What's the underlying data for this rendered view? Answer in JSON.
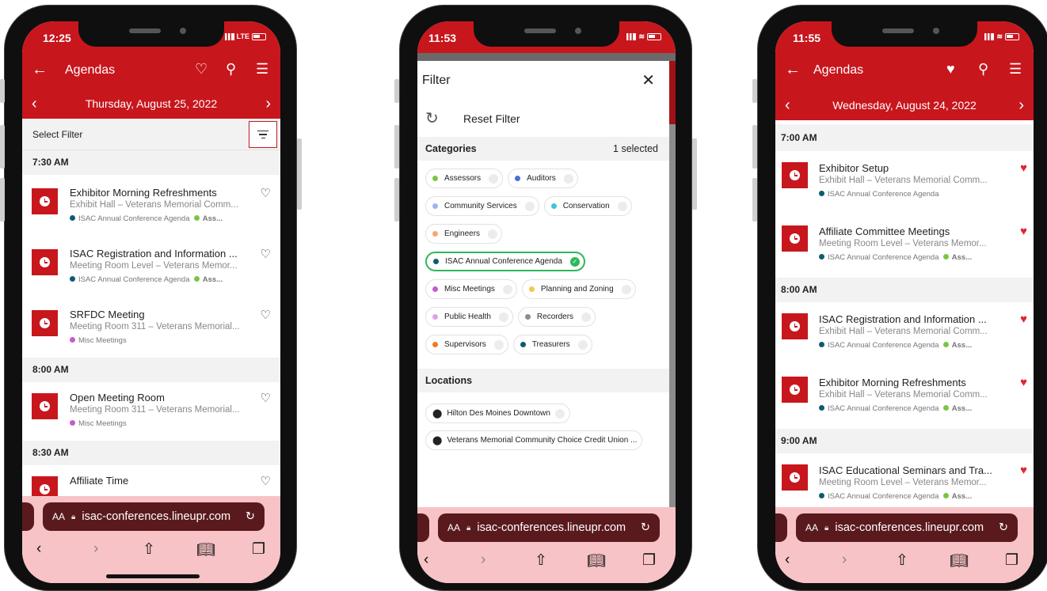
{
  "colors": {
    "brand_red": "#c8161d",
    "heart_red": "#e0262f",
    "selected_green": "#2fb858",
    "browser_pink": "#f7c3c6"
  },
  "phone1": {
    "status_time": "12:25",
    "network": "LTE",
    "header_title": "Agendas",
    "date": "Thursday, August 25, 2022",
    "filter_label": "Select Filter",
    "groups": [
      {
        "time": "7:30 AM",
        "items": [
          {
            "title": "Exhibitor Morning Refreshments",
            "location": "Exhibit Hall – Veterans Memorial Comm...",
            "tag1": "ISAC Annual Conference Agenda",
            "tag2": "Ass..."
          },
          {
            "title": "ISAC Registration and Information ...",
            "location": "Meeting Room Level – Veterans Memor...",
            "tag1": "ISAC Annual Conference Agenda",
            "tag2": "Ass..."
          },
          {
            "title": "SRFDC Meeting",
            "location": "Meeting Room 311 – Veterans Memorial...",
            "tag1": "Misc Meetings"
          }
        ]
      },
      {
        "time": "8:00 AM",
        "items": [
          {
            "title": "Open Meeting Room",
            "location": "Meeting Room 311 – Veterans Memorial...",
            "tag1": "Misc Meetings"
          }
        ]
      },
      {
        "time": "8:30 AM",
        "items": [
          {
            "title": "Affiliate Time"
          }
        ]
      }
    ],
    "url": "isac-conferences.lineupr.com",
    "aa": "AA"
  },
  "phone2": {
    "status_time": "11:53",
    "sheet_title": "Filter",
    "reset": "Reset Filter",
    "categories_title": "Categories",
    "selected_count": "1 selected",
    "categories": [
      {
        "name": "Assessors",
        "color": "#7cc544"
      },
      {
        "name": "Auditors",
        "color": "#4a6fd8"
      },
      {
        "name": "Community Services",
        "color": "#9db6ee"
      },
      {
        "name": "Conservation",
        "color": "#3cc6d8"
      },
      {
        "name": "Engineers",
        "color": "#f4a871"
      },
      {
        "name": "ISAC Annual Conference Agenda",
        "color": "#0d5c6e"
      },
      {
        "name": "Misc Meetings",
        "color": "#c75ad0"
      },
      {
        "name": "Planning and Zoning",
        "color": "#f2c84b"
      },
      {
        "name": "Public Health",
        "color": "#dfa3ec"
      },
      {
        "name": "Recorders",
        "color": "#8e8e8e"
      },
      {
        "name": "Supervisors",
        "color": "#ef7a22"
      },
      {
        "name": "Treasurers",
        "color": "#0d5c6e"
      }
    ],
    "locations_title": "Locations",
    "locations": [
      "Hilton Des Moines Downtown",
      "Veterans Memorial Community Choice Credit Union ..."
    ],
    "url": "isac-conferences.lineupr.com",
    "aa": "AA"
  },
  "phone3": {
    "status_time": "11:55",
    "header_title": "Agendas",
    "date": "Wednesday, August 24, 2022",
    "groups": [
      {
        "time": "7:00 AM",
        "items": [
          {
            "title": "Exhibitor Setup",
            "location": "Exhibit Hall – Veterans Memorial Comm...",
            "tag1": "ISAC Annual Conference Agenda"
          },
          {
            "title": "Affiliate Committee Meetings",
            "location": "Meeting Room Level – Veterans Memor...",
            "tag1": "ISAC Annual Conference Agenda",
            "tag2": "Ass..."
          }
        ]
      },
      {
        "time": "8:00 AM",
        "items": [
          {
            "title": "ISAC Registration and Information ...",
            "location": "Exhibit Hall – Veterans Memorial Comm...",
            "tag1": "ISAC Annual Conference Agenda",
            "tag2": "Ass..."
          },
          {
            "title": "Exhibitor Morning Refreshments",
            "location": "Exhibit Hall – Veterans Memorial Comm...",
            "tag1": "ISAC Annual Conference Agenda",
            "tag2": "Ass..."
          }
        ]
      },
      {
        "time": "9:00 AM",
        "items": [
          {
            "title": "ISAC Educational Seminars and Tra...",
            "location": "Meeting Room Level – Veterans Memor...",
            "tag1": "ISAC Annual Conference Agenda",
            "tag2": "Ass..."
          }
        ]
      }
    ],
    "url": "isac-conferences.lineupr.com",
    "aa": "AA"
  }
}
